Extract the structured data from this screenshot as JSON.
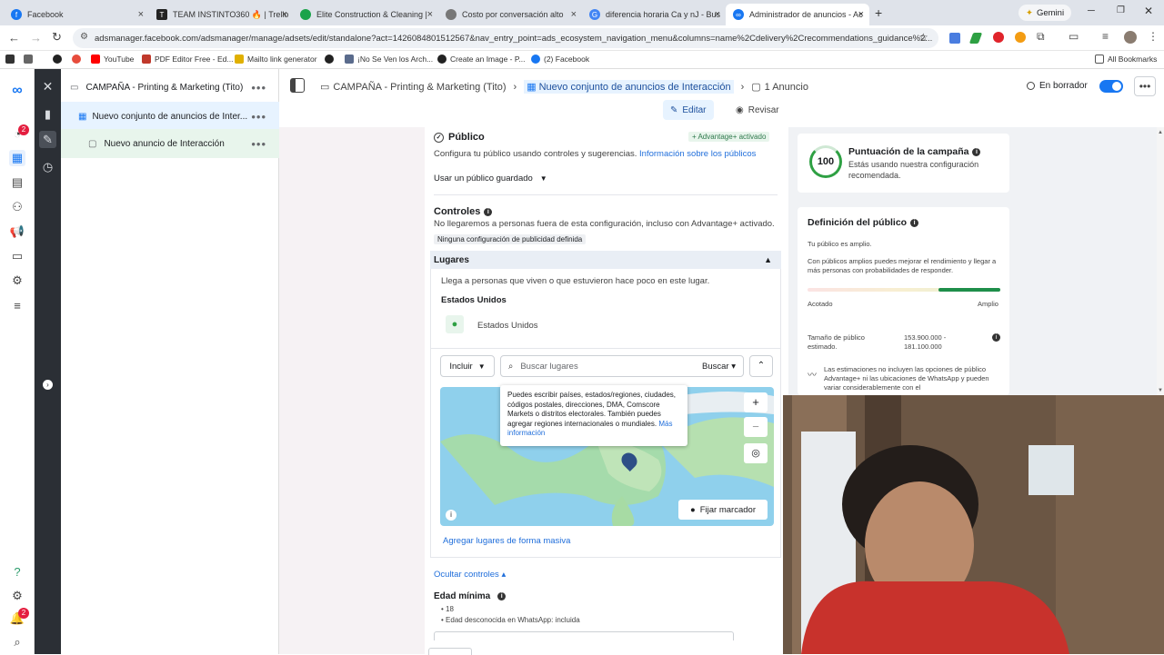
{
  "tabs": [
    {
      "title": "Facebook",
      "color": "#1877f2"
    },
    {
      "title": "TEAM INSTINTO360 🔥 | Trello",
      "color": "#222"
    },
    {
      "title": "Elite Construction & Cleaning |",
      "color": "#1aa34a"
    },
    {
      "title": "Costo por conversación alto",
      "color": "#555"
    },
    {
      "title": "diferencia horaria Ca y nJ - Bus",
      "color": "#4285f4"
    },
    {
      "title": "Administrador de anuncios - Ac",
      "color": "#1877f2"
    }
  ],
  "browser": {
    "url": "adsmanager.facebook.com/adsmanager/manage/adsets/edit/standalone?act=1426084801512567&nav_entry_point=ads_ecosystem_navigation_menu&columns=name%2Cdelivery%2Crecommendations_guidance%2...",
    "gemini": "Gemini",
    "all_bookmarks": "All Bookmarks"
  },
  "bookmarks": [
    "YouTube",
    "PDF Editor Free - Ed...",
    "Mailto link generator",
    "¡No Se Ven los Arch...",
    "Create an Image - P...",
    "(2) Facebook"
  ],
  "rail": {
    "notif_badge": "2",
    "bell_badge": "2"
  },
  "tree": {
    "campaign": "CAMPAÑA - Printing & Marketing (Tito)",
    "adset": "Nuevo conjunto de anuncios de Inter...",
    "ad": "Nuevo anuncio de Interacción"
  },
  "header": {
    "crumb1": "CAMPAÑA - Printing & Marketing (Tito)",
    "crumb2": "Nuevo conjunto de anuncios de Interacción",
    "crumb3": "1 Anuncio",
    "status": "En borrador",
    "edit": "Editar",
    "review": "Revisar"
  },
  "audience": {
    "title": "Público",
    "badge": "+ Advantage+ activado",
    "desc": "Configura tu público usando controles y sugerencias.",
    "desc_link": "Información sobre los públicos",
    "saved": "Usar un público guardado",
    "controls_title": "Controles",
    "controls_desc": "No llegaremos a personas fuera de esta configuración, incluso con Advantage+ activado.",
    "controls_chip": "Ninguna configuración de publicidad definida",
    "places_title": "Lugares",
    "places_desc": "Llega a personas que viven o que estuvieron hace poco en este lugar.",
    "country_heading": "Estados Unidos",
    "country": "Estados Unidos",
    "include": "Incluir",
    "search_placeholder": "Buscar lugares",
    "search_button": "Buscar",
    "tooltip": "Puedes escribir países, estados/regiones, ciudades, códigos postales, direcciones, DMA, Comscore Markets o distritos electorales. También puedes agregar regiones internacionales o mundiales.",
    "tooltip_link": "Más información",
    "pin": "Fijar marcador",
    "bulk": "Agregar lugares de forma masiva",
    "hide": "Ocultar controles ▴",
    "age_title": "Edad mínima",
    "age_value": "18",
    "age_note": "Edad desconocida en WhatsApp: incluida"
  },
  "score": {
    "value": "100",
    "title": "Puntuación de la campaña",
    "desc": "Estás usando nuestra configuración recomendada."
  },
  "definition": {
    "title": "Definición del público",
    "broad": "Tu público es amplio.",
    "note": "Con públicos amplios puedes mejorar el rendimiento y llegar a más personas con probabilidades de responder.",
    "left": "Acotado",
    "right": "Amplio",
    "size_label": "Tamaño de público estimado.",
    "size_value": "153.900.000 - 181.100.000",
    "disclaimer": "Las estimaciones no incluyen las opciones de público Advantage+ ni las ubicaciones de WhatsApp y pueden variar considerablemente con el"
  }
}
